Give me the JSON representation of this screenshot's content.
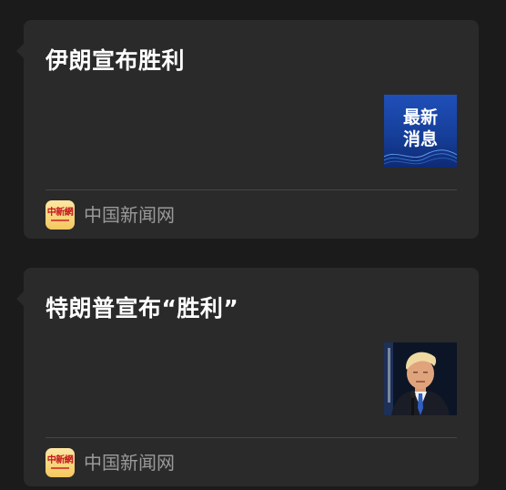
{
  "feed": {
    "items": [
      {
        "title": "伊朗宣布胜利",
        "thumbnail_icon": "breaking-news-thumbnail",
        "thumbnail_text_line1": "最新",
        "thumbnail_text_line2": "消息",
        "source_name": "中国新闻网",
        "source_logo_text": "中新網"
      },
      {
        "title": "特朗普宣布“胜利”",
        "thumbnail_icon": "portrait-photo-thumbnail",
        "source_name": "中国新闻网",
        "source_logo_text": "中新網"
      }
    ]
  },
  "colors": {
    "background": "#1b1b1b",
    "card": "#2a2a2a",
    "title_text": "#ffffff",
    "source_text": "#9a9a9a",
    "logo_bg": "#f4c85e",
    "logo_text": "#c4161c"
  }
}
